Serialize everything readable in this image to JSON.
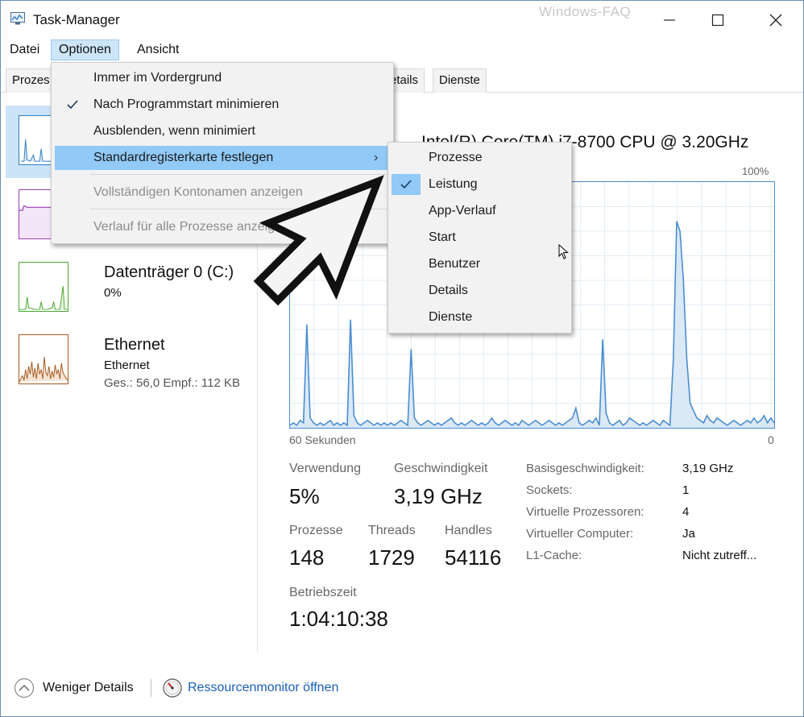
{
  "window": {
    "title": "Task-Manager",
    "watermark": "Windows-FAQ"
  },
  "menubar": {
    "items": [
      "Datei",
      "Optionen",
      "Ansicht"
    ],
    "active": "Optionen"
  },
  "tabs": {
    "visible": [
      "Prozes",
      "etails",
      "Dienste"
    ]
  },
  "sidebar": {
    "items": [
      {
        "title": "",
        "sub1": "",
        "sub2": "",
        "color": "#2b7fc7"
      },
      {
        "title": "",
        "sub1": "",
        "sub2": "",
        "color": "#9a3fb5"
      },
      {
        "title": "Datenträger 0 (C:)",
        "sub1": "0%",
        "sub2": "",
        "color": "#4aa832"
      },
      {
        "title": "Ethernet",
        "sub1": "Ethernet",
        "sub2": "Ges.: 56,0 Empf.: 112 KB",
        "color": "#a7591e"
      }
    ]
  },
  "cpu": {
    "name": "Intel(R) Core(TM) i7-8700 CPU @ 3.20GHz",
    "graph_max_label": "100%",
    "graph_left_label": "60 Sekunden",
    "graph_right_label": "0",
    "usage_series": [
      1,
      2,
      1,
      3,
      2,
      42,
      4,
      2,
      1,
      2,
      1,
      2,
      3,
      1,
      2,
      1,
      2,
      1,
      44,
      5,
      2,
      1,
      2,
      3,
      2,
      1,
      2,
      1,
      2,
      1,
      2,
      1,
      2,
      3,
      2,
      1,
      32,
      4,
      2,
      1,
      2,
      3,
      2,
      1,
      2,
      1,
      2,
      3,
      4,
      2,
      1,
      2,
      1,
      2,
      3,
      2,
      1,
      2,
      1,
      2,
      4,
      2,
      1,
      2,
      3,
      2,
      1,
      2,
      1,
      3,
      2,
      1,
      2,
      3,
      2,
      1,
      2,
      3,
      2,
      1,
      2,
      1,
      2,
      3,
      4,
      8,
      2,
      1,
      2,
      3,
      2,
      4,
      1,
      36,
      6,
      2,
      1,
      2,
      3,
      1,
      2,
      4,
      3,
      2,
      1,
      2,
      1,
      2,
      3,
      2,
      1,
      3,
      2,
      1,
      28,
      84,
      80,
      60,
      28,
      10,
      7,
      4,
      3,
      2,
      5,
      3,
      2,
      4,
      3,
      2,
      1,
      2,
      3,
      2,
      1,
      2,
      3,
      2,
      4,
      2,
      3,
      5,
      2,
      4,
      2
    ],
    "usage_color": "#4a8ed0",
    "fill_color": "#dbe8f6"
  },
  "stats": {
    "verwendung_label": "Verwendung",
    "verwendung_value": "5%",
    "geschwindigkeit_label": "Geschwindigkeit",
    "geschwindigkeit_value": "3,19 GHz",
    "prozesse_label": "Prozesse",
    "prozesse_value": "148",
    "threads_label": "Threads",
    "threads_value": "1729",
    "handles_label": "Handles",
    "handles_value": "54116",
    "betriebszeit_label": "Betriebszeit",
    "betriebszeit_value": "1:04:10:38"
  },
  "info": [
    {
      "label": "Basisgeschwindigkeit:",
      "value": "3,19 GHz"
    },
    {
      "label": "Sockets:",
      "value": "1"
    },
    {
      "label": "Virtuelle Prozessoren:",
      "value": "4"
    },
    {
      "label": "Virtueller Computer:",
      "value": "Ja"
    },
    {
      "label": "L1-Cache:",
      "value": "Nicht zutreff..."
    }
  ],
  "footer": {
    "less_details": "Weniger Details",
    "resource_monitor": "Ressourcenmonitor öffnen"
  },
  "options_menu": {
    "items": [
      {
        "label": "Immer im Vordergrund",
        "checked": false,
        "disabled": false,
        "highlighted": false,
        "submenu": false
      },
      {
        "label": "Nach Programmstart minimieren",
        "checked": true,
        "disabled": false,
        "highlighted": false,
        "submenu": false
      },
      {
        "label": "Ausblenden, wenn minimiert",
        "checked": false,
        "disabled": false,
        "highlighted": false,
        "submenu": false
      },
      {
        "label": "Standardregisterkarte festlegen",
        "checked": false,
        "disabled": false,
        "highlighted": true,
        "submenu": true
      },
      {
        "label": "Vollständigen Kontonamen anzeigen",
        "checked": false,
        "disabled": true,
        "highlighted": false,
        "submenu": false
      },
      {
        "label": "Verlauf für alle Prozesse anzeigen",
        "checked": false,
        "disabled": true,
        "highlighted": false,
        "submenu": false
      }
    ]
  },
  "default_tab_submenu": {
    "items": [
      {
        "label": "Prozesse",
        "checked": false
      },
      {
        "label": "Leistung",
        "checked": true
      },
      {
        "label": "App-Verlauf",
        "checked": false
      },
      {
        "label": "Start",
        "checked": false
      },
      {
        "label": "Benutzer",
        "checked": false
      },
      {
        "label": "Details",
        "checked": false
      },
      {
        "label": "Dienste",
        "checked": false
      }
    ]
  }
}
